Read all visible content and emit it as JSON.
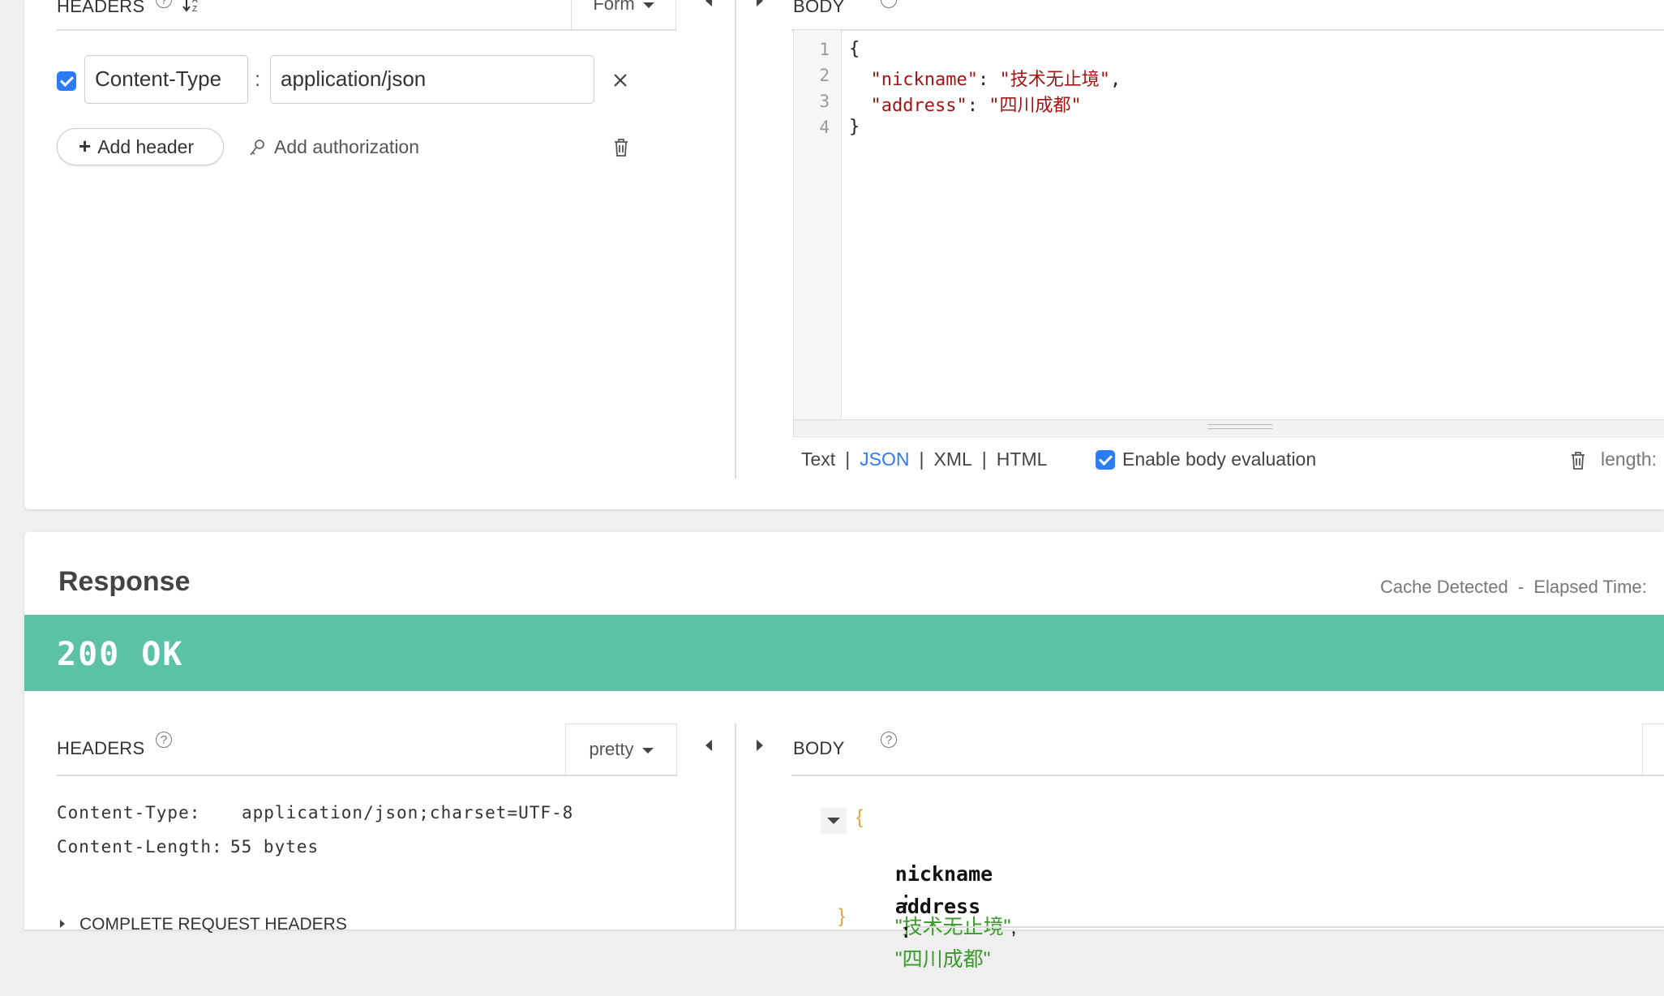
{
  "request": {
    "headers_panel": {
      "title": "HEADERS",
      "help": "?",
      "sort_icon": "sort-az-icon",
      "mode_label": "Form",
      "rows": [
        {
          "enabled": true,
          "name": "Content-Type",
          "separator": ":",
          "value": "application/json"
        }
      ],
      "add_header_label": "Add header",
      "add_auth_label": "Add authorization"
    },
    "body_panel": {
      "title": "BODY",
      "line_numbers": [
        "1",
        "2",
        "3",
        "4"
      ],
      "lines": [
        {
          "pre": "{",
          "key": "",
          "mid": "",
          "val": "",
          "post": ""
        },
        {
          "pre": "  ",
          "key": "\"nickname\"",
          "mid": ": ",
          "val": "\"技术无止境\"",
          "post": ","
        },
        {
          "pre": "  ",
          "key": "\"address\"",
          "mid": ": ",
          "val": "\"四川成都\"",
          "post": ""
        },
        {
          "pre": "}",
          "key": "",
          "mid": "",
          "val": "",
          "post": ""
        }
      ],
      "formats": [
        "Text",
        "JSON",
        "XML",
        "HTML"
      ],
      "active_format": "JSON",
      "enable_evaluation_label": "Enable body evaluation",
      "enable_evaluation_checked": true,
      "length_label": "length:"
    }
  },
  "response": {
    "title": "Response",
    "cache_label": "Cache Detected",
    "dash": "-",
    "elapsed_label": "Elapsed Time:",
    "status": "200 OK",
    "status_color": "#5bc2a6",
    "headers_panel": {
      "title": "HEADERS",
      "help": "?",
      "mode_label": "pretty",
      "headers": [
        {
          "name": "Content-Type:",
          "value": "application/json;charset=UTF-8"
        },
        {
          "name": "Content-Length:",
          "value": "55 bytes"
        }
      ],
      "complete_label": "COMPLETE REQUEST HEADERS"
    },
    "body_panel": {
      "title": "BODY",
      "help": "?",
      "open_brace": "{",
      "close_brace": "}",
      "fields": [
        {
          "key": "nickname",
          "colon": ":",
          "value": "\"技术无止境\"",
          "comma": ","
        },
        {
          "key": "address",
          "colon": ":",
          "value": "\"四川成都\"",
          "comma": ""
        }
      ]
    }
  }
}
